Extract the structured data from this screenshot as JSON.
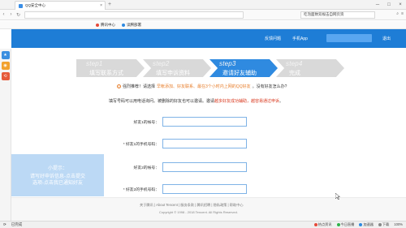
{
  "browser": {
    "tab_title": "QQ安全中心",
    "tab_close": "×",
    "new_tab": "+",
    "search_text": "吃泡面致双规击自网页资",
    "window_controls": [
      "─",
      "□",
      "×"
    ],
    "bookmarks": [
      {
        "label": "腾讯中心",
        "color": "#e64a3a"
      },
      {
        "label": "读腾部署",
        "color": "#2f8ae0"
      }
    ]
  },
  "header": {
    "feedback": "反馈问题",
    "mobile_app": "手机App",
    "logout": "退出"
  },
  "steps": [
    {
      "name": "step1",
      "label": "填写联系方式"
    },
    {
      "name": "step2",
      "label": "填写申诉资料"
    },
    {
      "name": "step3",
      "label": "邀请好友辅助"
    },
    {
      "name": "step4",
      "label": "完成"
    }
  ],
  "active_step": 3,
  "tip": {
    "prefix": "强烈推荐！请选择",
    "highlight": "早帐添加、好友联系、最在3个小时内上网的QQ好友",
    "suffix": "。没有好友怎么办?"
  },
  "description": {
    "prefix": "填写号码可以用电话询问。被删除的好友也可以邀请。邀请",
    "highlight": "越多好友成功辅助，越容易通过申诉",
    "suffix": "。"
  },
  "form": [
    {
      "label": "好友1的帐号：",
      "value": ""
    },
    {
      "label": "* 好友1的手机号码：",
      "value": ""
    },
    {
      "label": "好友2的帐号：",
      "value": ""
    },
    {
      "label": "* 好友2的手机号码：",
      "value": ""
    }
  ],
  "footer": {
    "links": "关于腾讯  |  About Tencent  |  服务条款  |  腾讯招聘  |  隐私政策  |  帮助中心",
    "copyright": "Copyright © 1998 - 2018 Tencent. All Rights Reserved."
  },
  "tip_panel": {
    "title": "小提示：",
    "body_line1": "请写好申诉信息-点击提交",
    "body_line2": "选项-点击我已通知好友"
  },
  "statusbar": {
    "left": [
      "⟳",
      "已完成"
    ],
    "right": [
      "热点资讯",
      "今日直播",
      "加速器",
      "下载",
      "100%"
    ]
  }
}
